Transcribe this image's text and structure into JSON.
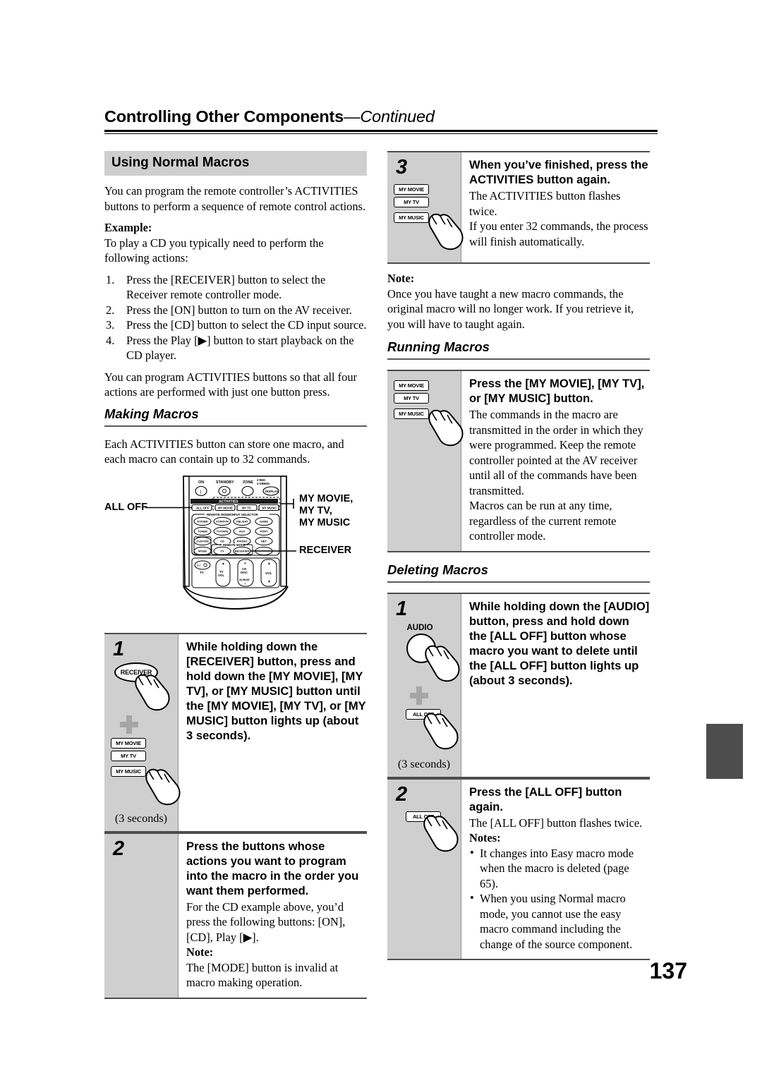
{
  "header": {
    "title_main": "Controlling Other Components",
    "title_cont": "—Continued"
  },
  "left_column": {
    "band_title": "Using Normal Macros",
    "intro": "You can program the remote controller’s ACTIVITIES buttons to perform a sequence of remote control actions.",
    "example_label": "Example:",
    "example_lead": "To play a CD you typically need to perform the following actions:",
    "example_steps": [
      {
        "num": "1.",
        "text": "Press the [RECEIVER] button to select the Receiver remote controller mode."
      },
      {
        "num": "2.",
        "text": "Press the [ON] button to turn on the AV receiver."
      },
      {
        "num": "3.",
        "text": "Press the [CD] button to select the CD input source."
      },
      {
        "num": "4.",
        "text": "Press the Play [▶] button to start playback on the CD player."
      }
    ],
    "closing": "You can program ACTIVITIES buttons so that all four actions are performed with just one button press.",
    "making_macros": {
      "title": "Making Macros",
      "body": "Each ACTIVITIES button can store one macro, and each macro can contain up to 32 commands."
    },
    "remote_figure": {
      "callout_all_off": "ALL OFF",
      "callout_my_line1": "MY MOVIE,",
      "callout_my_line2": "MY TV,",
      "callout_my_line3": "MY MUSIC",
      "callout_receiver": "RECEIVER",
      "top_labels": [
        "ON",
        "STANDBY",
        "ZONE",
        "2 RED",
        "3 GREEN"
      ],
      "display_key": "DISPLAY",
      "activities_label": "ACTIVITIES",
      "activities_keys": [
        "ALL OFF",
        "MY MOVIE",
        "MY TV",
        "MY MUSIC"
      ],
      "selector_label": "REMOTE MODE/INPUT SELECTOR",
      "selector_keys": [
        "DVD/BD",
        "VCR/DVR",
        "CBL/SAT",
        "GAME",
        "TUNER",
        "TV/TAPE",
        "AUX",
        "PORT",
        "CUSTOM",
        "CD",
        "PHONO",
        "NET"
      ],
      "remote_mode_label": "REMOTE MODE",
      "mode_row_keys": [
        "MODE",
        "TV",
        "RECEIVER",
        ""
      ],
      "bottom_keys": [
        "I/⏻",
        "TV",
        "TV VOL",
        "CH DISC",
        "ALBUM",
        "VOL"
      ]
    },
    "step1": {
      "num": "1",
      "head": "While holding down the [RECEIVER] button, press and hold down the [MY MOVIE], [MY TV], or [MY MUSIC] button until the [MY MOVIE], [MY TV], or [MY MUSIC] button lights up (about 3 seconds).",
      "keys": [
        "RECEIVER",
        "MY MOVIE",
        "MY TV",
        "MY MUSIC"
      ],
      "seconds": "(3 seconds)"
    },
    "step2": {
      "num": "2",
      "head": "Press the buttons whose actions you want to program into the macro in the order you want them performed.",
      "body": "For the CD example above, you’d press the following buttons: [ON], [CD], Play [▶].",
      "note_label": "Note:",
      "note_body": "The [MODE] button is invalid at macro making operation."
    }
  },
  "right_column": {
    "step3": {
      "num": "3",
      "head": "When you’ve finished, press the ACTIVITIES button again.",
      "body1": "The ACTIVITIES button flashes twice.",
      "body2": "If you enter 32 commands, the process will finish automatically.",
      "keys": [
        "MY MOVIE",
        "MY TV",
        "MY MUSIC"
      ]
    },
    "note": {
      "label": "Note:",
      "body": "Once you have taught a new macro commands, the original macro will no longer work. If you retrieve it, you will have to taught again."
    },
    "running_macros": {
      "title": "Running Macros",
      "step": {
        "head": "Press the [MY MOVIE], [MY TV], or [MY MUSIC] button.",
        "body1": "The commands in the macro are transmitted in the order in which they were programmed. Keep the remote controller pointed at the AV receiver until all of the commands have been transmitted.",
        "body2": "Macros can be run at any time, regardless of the current remote controller mode.",
        "keys": [
          "MY MOVIE",
          "MY TV",
          "MY MUSIC"
        ]
      }
    },
    "deleting_macros": {
      "title": "Deleting Macros",
      "step1": {
        "num": "1",
        "head": "While holding down the [AUDIO] button, press and hold down the [ALL OFF] button whose macro you want to delete until the [ALL OFF] button lights up (about 3 seconds).",
        "audio_label": "AUDIO",
        "all_off_label": "ALL OFF",
        "seconds": "(3 seconds)"
      },
      "step2": {
        "num": "2",
        "head": "Press the [ALL OFF] button again.",
        "body": "The [ALL OFF] button flashes twice.",
        "notes_label": "Notes:",
        "notes": [
          "It changes into Easy macro mode when the macro is deleted (page 65).",
          "When you using Normal macro mode, you cannot use the easy macro command including the change of the source component."
        ],
        "all_off_label": "ALL OFF"
      }
    }
  },
  "footer": {
    "page_number": "137"
  }
}
